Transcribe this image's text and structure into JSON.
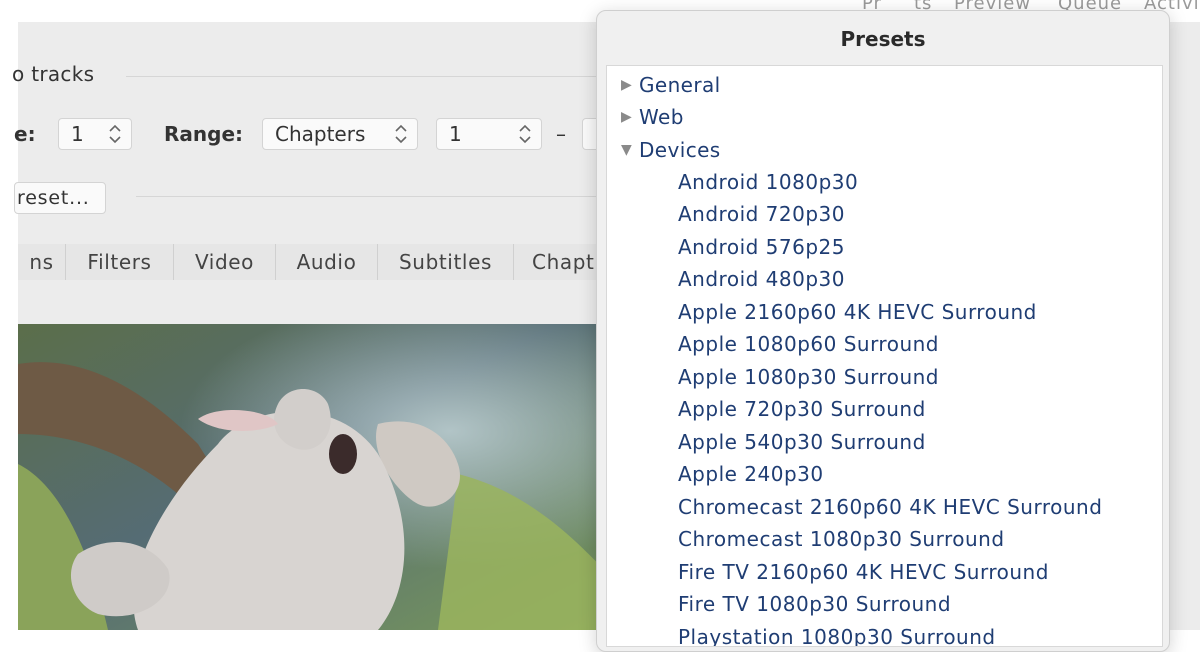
{
  "toolbar": {
    "items": [
      "Pr",
      "ts",
      "Preview",
      "Queue",
      "Activity"
    ]
  },
  "tracks_label": "o tracks",
  "controls": {
    "angle_label": "e:",
    "angle_value": "1",
    "range_label": "Range:",
    "range_type": "Chapters",
    "range_start": "1",
    "range_dash": "–"
  },
  "preset_button": "reset...",
  "tabs": [
    "ns",
    "Filters",
    "Video",
    "Audio",
    "Subtitles",
    "Chapt"
  ],
  "presets": {
    "title": "Presets",
    "groups": [
      {
        "label": "General",
        "expanded": false
      },
      {
        "label": "Web",
        "expanded": false
      },
      {
        "label": "Devices",
        "expanded": true
      }
    ],
    "device_presets": [
      "Android 1080p30",
      "Android 720p30",
      "Android 576p25",
      "Android 480p30",
      "Apple 2160p60 4K HEVC Surround",
      "Apple 1080p60 Surround",
      "Apple 1080p30 Surround",
      "Apple 720p30 Surround",
      "Apple 540p30 Surround",
      "Apple 240p30",
      "Chromecast 2160p60 4K HEVC Surround",
      "Chromecast 1080p30 Surround",
      "Fire TV 2160p60 4K HEVC Surround",
      "Fire TV 1080p30 Surround",
      "Playstation 1080p30 Surround"
    ]
  },
  "icons": {
    "collapsed": "disclosure-right-icon",
    "expanded": "disclosure-down-icon",
    "stepper": "up-down-chevron-icon"
  },
  "colors": {
    "preset_text": "#1f3d73",
    "panel_bg": "#f0f0f0",
    "window_bg": "#ececec"
  }
}
